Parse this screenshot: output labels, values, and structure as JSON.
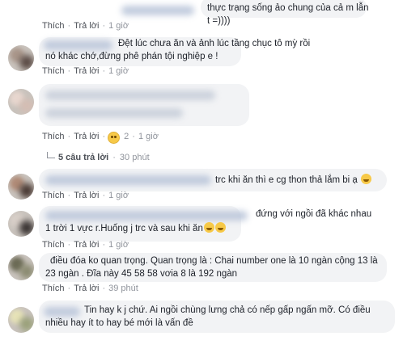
{
  "actions": {
    "like": "Thích",
    "reply": "Trả lời",
    "sep": "·"
  },
  "comments": [
    {
      "text": "thực trạng sống ảo chung của cả m lẫn t =))))",
      "time": "1 giờ"
    },
    {
      "text": "Đệt lúc chưa ăn và ảnh lúc tầng chục tô mỳ rồi nó khác chớ,đừng phê phán tội nghiệp e !",
      "time": "1 giờ"
    },
    {
      "text": "",
      "time": "1 giờ",
      "reaction_count": "2"
    },
    {
      "text": "trc khi ăn thì e cg thon thả lắm bi ạ",
      "time": "1 giờ"
    },
    {
      "text_line1": "đứng với ngồi đã khác nhau",
      "text_line2": "1 trời 1 vực r.Huống j trc và sau khi ăn",
      "time": "1 giờ"
    },
    {
      "text": "điều đóa ko quan trọng. Quan trọng là : Chai number one là 10 ngàn cộng 13 là 23 ngàn . Đĩa này 45 58 58 vơia 8 là 192 ngàn",
      "time": "39 phút"
    },
    {
      "text": "Tin hay k j chứ. Ai ngồi chùng lưng chả có nếp gấp ngấn mỡ. Có điều nhiều hay ít to hay bé mới là vấn đề",
      "time": ""
    }
  ],
  "replies": {
    "label": "5 câu trả lời",
    "time": "30 phút"
  },
  "colors": {
    "link": "#4b4f56",
    "meta": "#90949c",
    "bubble": "#f2f3f5",
    "emoji": "#f7c948"
  }
}
